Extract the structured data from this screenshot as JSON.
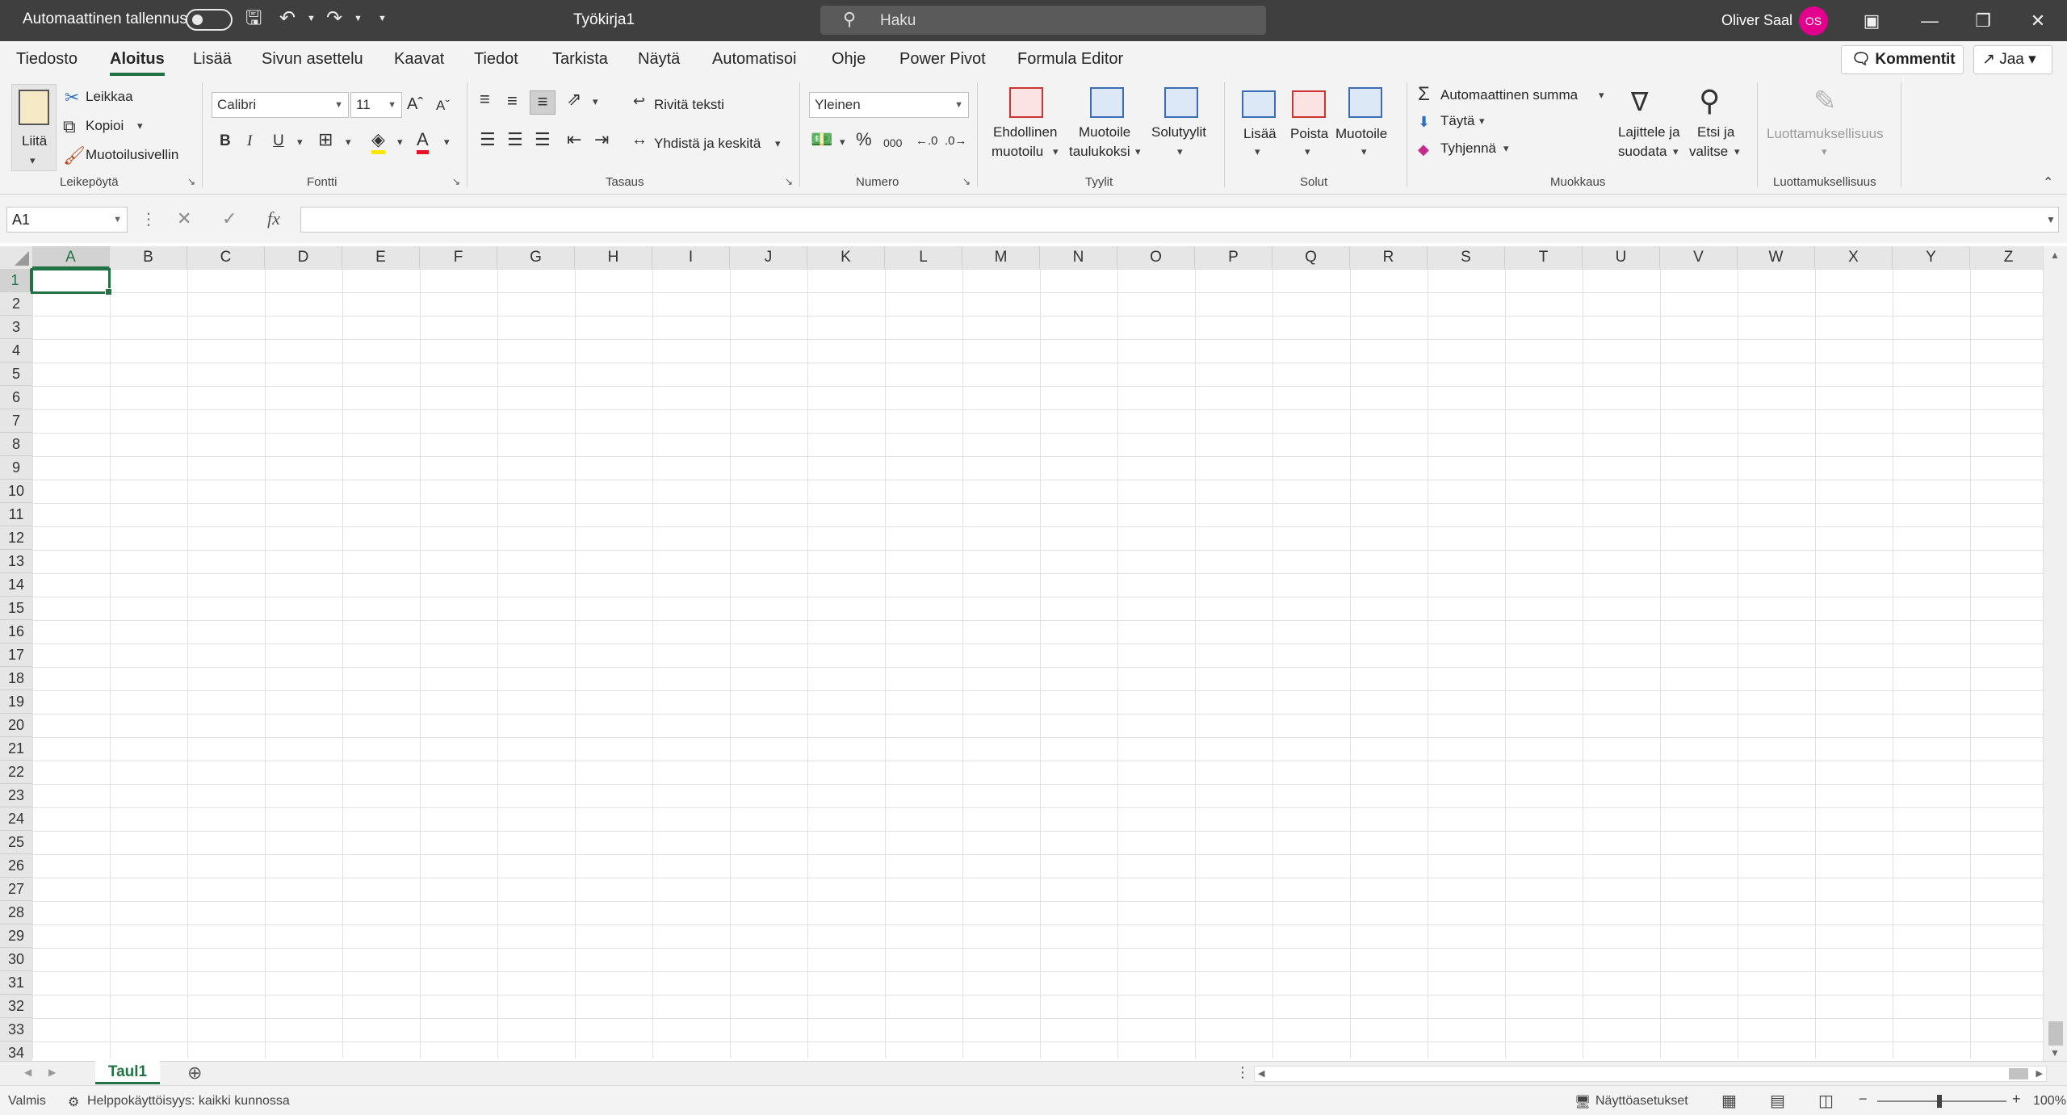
{
  "titlebar": {
    "autosave_label": "Automaattinen tallennus",
    "doc_title": "Työkirja1",
    "search_placeholder": "Haku",
    "user_name": "Oliver Saal",
    "user_initials": "OS",
    "avatar_color": "#e3008c"
  },
  "menu": {
    "tabs": [
      "Tiedosto",
      "Aloitus",
      "Lisää",
      "Sivun asettelu",
      "Kaavat",
      "Tiedot",
      "Tarkista",
      "Näytä",
      "Automatisoi",
      "Ohje",
      "Power Pivot",
      "Formula Editor"
    ],
    "active_tab": "Aloitus",
    "comments_label": "Kommentit",
    "share_label": "Jaa"
  },
  "ribbon": {
    "clipboard": {
      "paste": "Liitä",
      "cut": "Leikkaa",
      "copy": "Kopioi",
      "format_painter": "Muotoilusivellin",
      "label": "Leikepöytä"
    },
    "font": {
      "name": "Calibri",
      "size": "11",
      "bold": "B",
      "italic": "I",
      "underline": "U",
      "label": "Fontti"
    },
    "alignment": {
      "wrap_text": "Rivitä teksti",
      "merge_center": "Yhdistä ja keskitä",
      "label": "Tasaus"
    },
    "number": {
      "format": "Yleinen",
      "percent": "%",
      "thousands": "000",
      "label": "Numero"
    },
    "styles": {
      "conditional_1": "Ehdollinen",
      "conditional_2": "muotoilu",
      "table_1": "Muotoile",
      "table_2": "taulukoksi",
      "cell_styles": "Solutyylit",
      "label": "Tyylit"
    },
    "cells": {
      "insert": "Lisää",
      "delete": "Poista",
      "format": "Muotoile",
      "label": "Solut"
    },
    "editing": {
      "autosum": "Automaattinen summa",
      "fill": "Täytä",
      "clear": "Tyhjennä",
      "sort_1": "Lajittele ja",
      "sort_2": "suodata",
      "find_1": "Etsi ja",
      "find_2": "valitse",
      "label": "Muokkaus"
    },
    "sensitivity": {
      "button": "Luottamuksellisuus",
      "label": "Luottamuksellisuus"
    }
  },
  "formula_bar": {
    "name_box": "A1",
    "fx": "fx",
    "value": ""
  },
  "grid": {
    "columns": [
      "A",
      "B",
      "C",
      "D",
      "E",
      "F",
      "G",
      "H",
      "I",
      "J",
      "K",
      "L",
      "M",
      "N",
      "O",
      "P",
      "Q",
      "R",
      "S",
      "T",
      "U",
      "V",
      "W",
      "X",
      "Y",
      "Z"
    ],
    "rows": [
      "1",
      "2",
      "3",
      "4",
      "5",
      "6",
      "7",
      "8",
      "9",
      "10",
      "11",
      "12",
      "13",
      "14",
      "15",
      "16",
      "17",
      "18",
      "19",
      "20",
      "21",
      "22",
      "23",
      "24",
      "25",
      "26",
      "27",
      "28",
      "29",
      "30",
      "31",
      "32",
      "33",
      "34"
    ],
    "selected_cell": "A1",
    "accent_color": "#217346"
  },
  "sheets": {
    "tabs": [
      "Taul1"
    ],
    "active": "Taul1"
  },
  "status": {
    "ready": "Valmis",
    "accessibility": "Helppokäyttöisyys: kaikki kunnossa",
    "display_settings": "Näyttöasetukset",
    "zoom": "100%",
    "zoom_fraction": 1.0
  }
}
